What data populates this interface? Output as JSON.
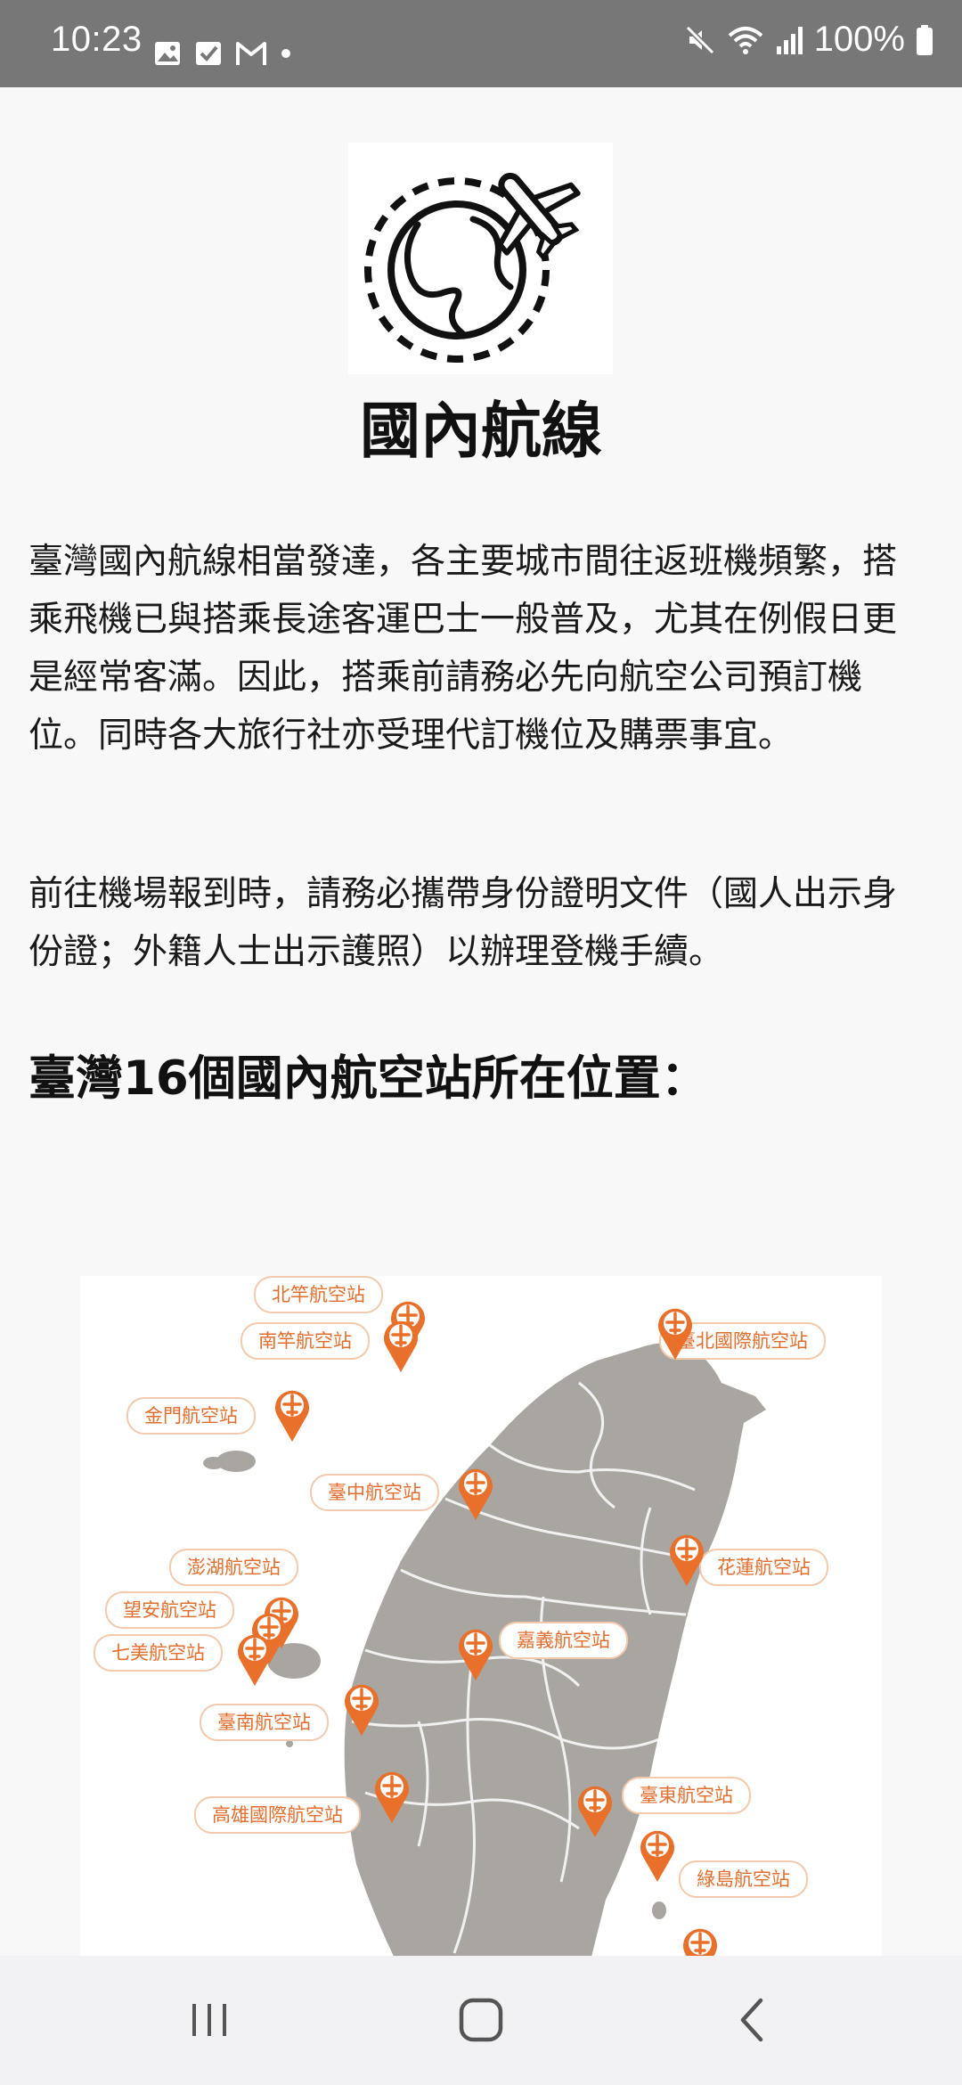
{
  "status_bar": {
    "time": "10:23",
    "battery": "100%",
    "left_icons": [
      "photo-icon",
      "checkbox-icon",
      "gmail-icon",
      "dot-icon"
    ],
    "right_icons": [
      "mute-icon",
      "wifi-icon",
      "signal-icon",
      "battery-icon"
    ]
  },
  "page": {
    "title": "國內航線",
    "paragraphs": [
      "臺灣國內航線相當發達，各主要城市間往返班機頻繁，搭乘飛機已與搭乘長途客運巴士一般普及，尤其在例假日更是經常客滿。因此，搭乘前請務必先向航空公司預訂機位。同時各大旅行社亦受理代訂機位及購票事宜。",
      "前往機場報到時，請務必攜帶身份證明文件（國人出示身份證；外籍人士出示護照）以辦理登機手續。"
    ],
    "section_heading": "臺灣16個國內航空站所在位置："
  },
  "map": {
    "accent_color": "#e8702a",
    "land_color": "#a9a6a1",
    "labels": {
      "beigan": "北竿航空站",
      "nangan": "南竿航空站",
      "taipei": "臺北國際航空站",
      "kinmen": "金門航空站",
      "taichung": "臺中航空站",
      "penghu": "澎湖航空站",
      "hualien": "花蓮航空站",
      "wangan": "望安航空站",
      "chiayi": "嘉義航空站",
      "qimei": "七美航空站",
      "tainan": "臺南航空站",
      "taitung": "臺東航空站",
      "kaohsiung": "高雄國際航空站",
      "lyudao": "綠島航空站"
    }
  },
  "nav_bar": {
    "buttons": [
      "recent-apps-icon",
      "home-icon",
      "back-icon"
    ]
  }
}
